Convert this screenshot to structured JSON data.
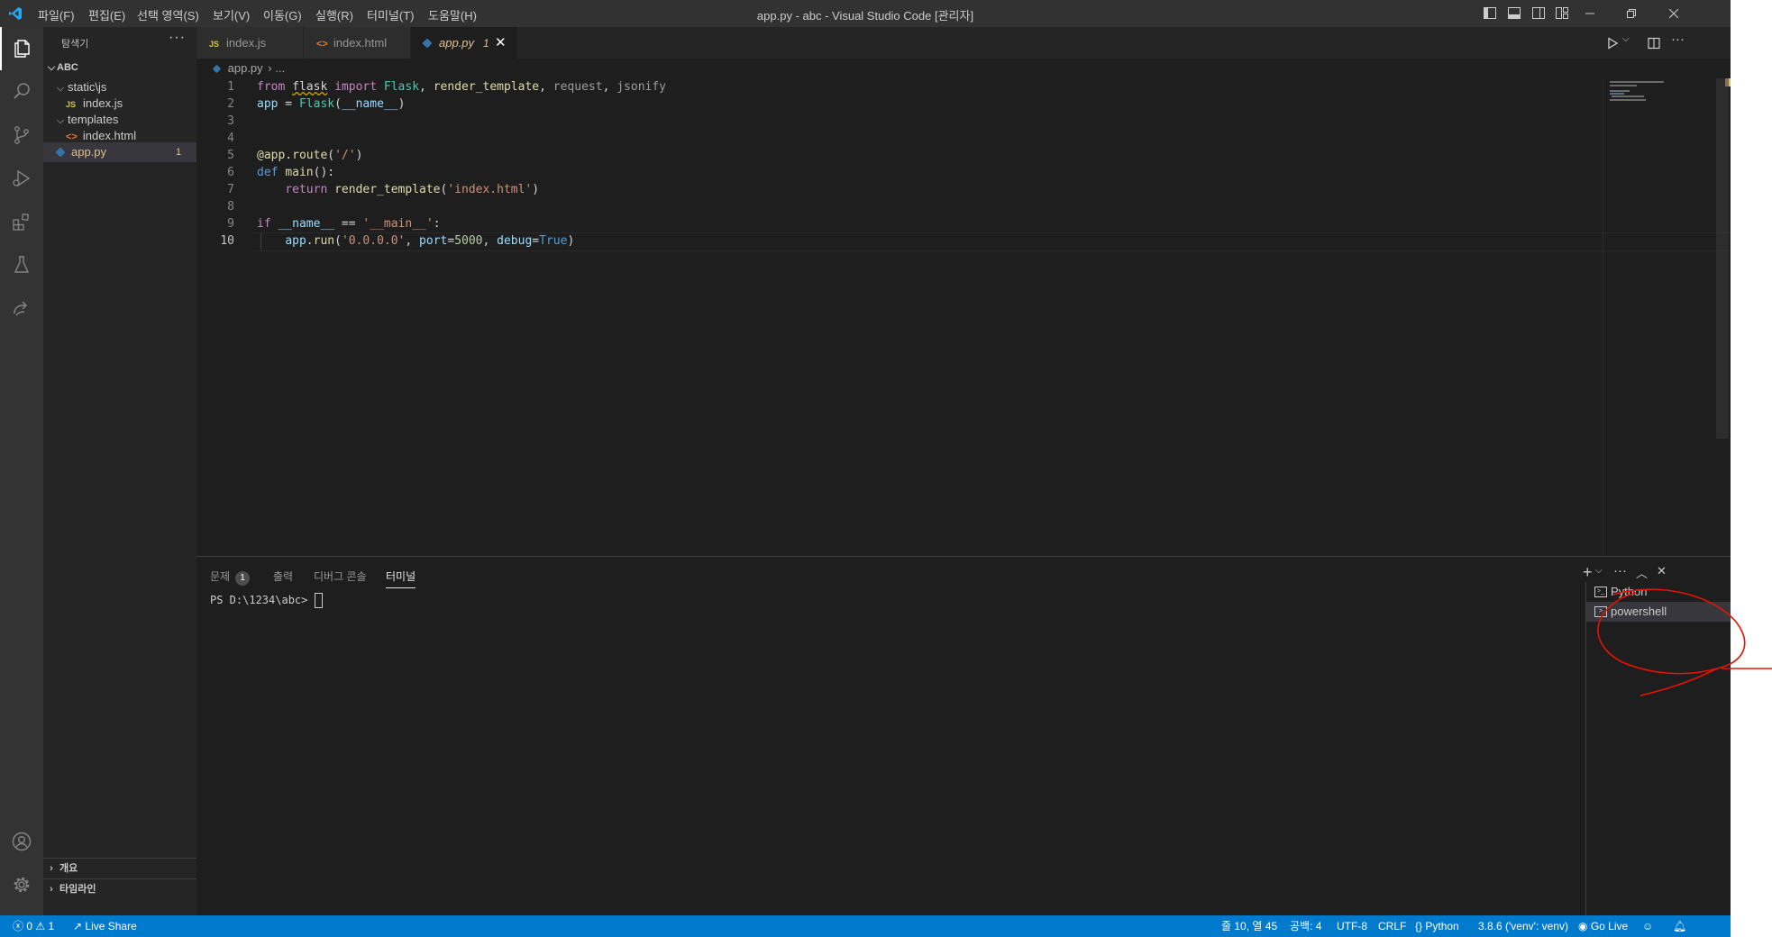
{
  "window": {
    "title": "app.py - abc - Visual Studio Code [관리자]",
    "menu": [
      "파일(F)",
      "편집(E)",
      "선택 영역(S)",
      "보기(V)",
      "이동(G)",
      "실행(R)",
      "터미널(T)",
      "도움말(H)"
    ]
  },
  "sidebar": {
    "header": "탐색기",
    "root": "ABC",
    "items": [
      {
        "label": "static\\js",
        "type": "folder"
      },
      {
        "label": "index.js",
        "type": "js"
      },
      {
        "label": "templates",
        "type": "folder"
      },
      {
        "label": "index.html",
        "type": "html"
      },
      {
        "label": "app.py",
        "type": "py",
        "badge": "1"
      }
    ],
    "outline": "개요",
    "timeline": "타임라인"
  },
  "tabs": [
    {
      "label": "index.js"
    },
    {
      "label": "index.html"
    },
    {
      "label": "app.py",
      "badge": "1"
    }
  ],
  "breadcrumb": {
    "file": "app.py",
    "more": "..."
  },
  "editor": {
    "line_numbers": [
      "1",
      "2",
      "3",
      "4",
      "5",
      "6",
      "7",
      "8",
      "9",
      "10"
    ],
    "current_line": "10"
  },
  "panel": {
    "tabs": [
      {
        "label": "문제",
        "badge": "1"
      },
      {
        "label": "출력"
      },
      {
        "label": "디버그 콘솔"
      },
      {
        "label": "터미널"
      }
    ],
    "prompt": "PS D:\\1234\\abc> ",
    "terminals": [
      "Python",
      "powershell"
    ]
  },
  "statusbar": {
    "errors": "0",
    "warnings": "1",
    "live_share": "Live Share",
    "position": "줄 10, 열 45",
    "spaces": "공백: 4",
    "encoding": "UTF-8",
    "eol": "CRLF",
    "language": "Python",
    "interpreter": "3.8.6 ('venv': venv)",
    "go_live": "Go Live"
  },
  "colors": {
    "accent": "#007acc",
    "modified": "#e2c08d",
    "annotation": "#e51400"
  }
}
